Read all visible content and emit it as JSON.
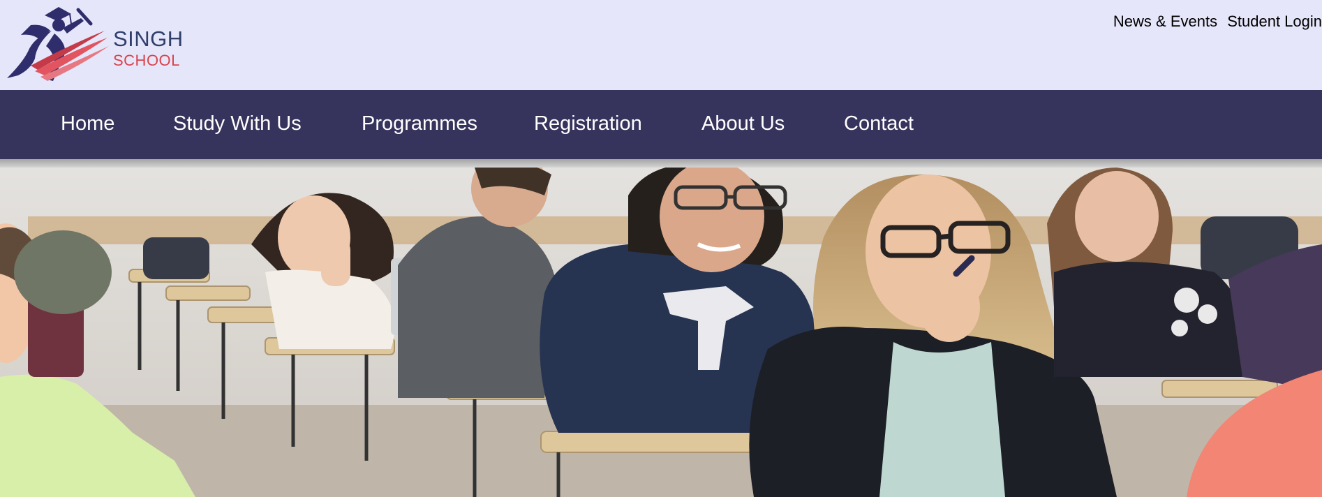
{
  "brand": {
    "name": "SINGH",
    "subtitle": "SCHOOL",
    "logo_icon": "graduate-runner-icon"
  },
  "top_links": [
    {
      "label": "News & Events"
    },
    {
      "label": "Student Login"
    }
  ],
  "nav": {
    "items": [
      {
        "label": "Home"
      },
      {
        "label": "Study With Us"
      },
      {
        "label": "Programmes"
      },
      {
        "label": "Registration"
      },
      {
        "label": "About Us"
      },
      {
        "label": "Contact"
      }
    ]
  },
  "colors": {
    "topbar_bg": "#e6e6fa",
    "nav_bg": "#36335c",
    "nav_text": "#ffffff",
    "logo_navy": "#2f3e6b",
    "logo_red": "#d9434b"
  },
  "hero": {
    "icon": "classroom-students-photo"
  }
}
